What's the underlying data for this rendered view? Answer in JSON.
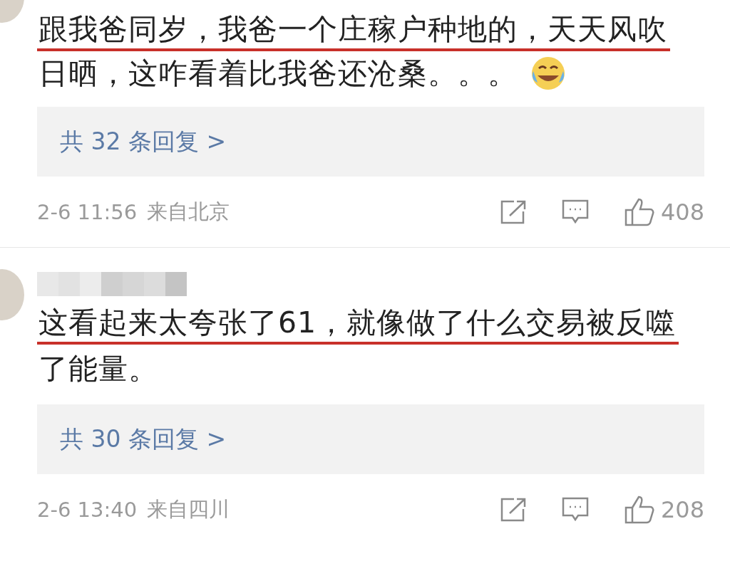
{
  "comments": [
    {
      "has_name": false,
      "lines": [
        {
          "text": "跟我爸同岁，我爸一个庄稼户种地的，天天风吹",
          "underlined": true
        },
        {
          "text": "日晒，这咋看着比我爸还沧桑。。。",
          "underlined": false,
          "emoji": true
        }
      ],
      "replies": "共 32 条回复 >",
      "time": "2-6 11:56",
      "location": "来自北京",
      "likes": "408"
    },
    {
      "has_name": true,
      "lines": [
        {
          "text": "这看起来太夸张了61，就像做了什么交易被反噬",
          "underlined": true
        },
        {
          "text": "了能量。",
          "underlined": false,
          "emoji": false
        }
      ],
      "replies": "共 30 条回复 >",
      "time": "2-6 13:40",
      "location": "来自四川",
      "likes": "208"
    }
  ]
}
